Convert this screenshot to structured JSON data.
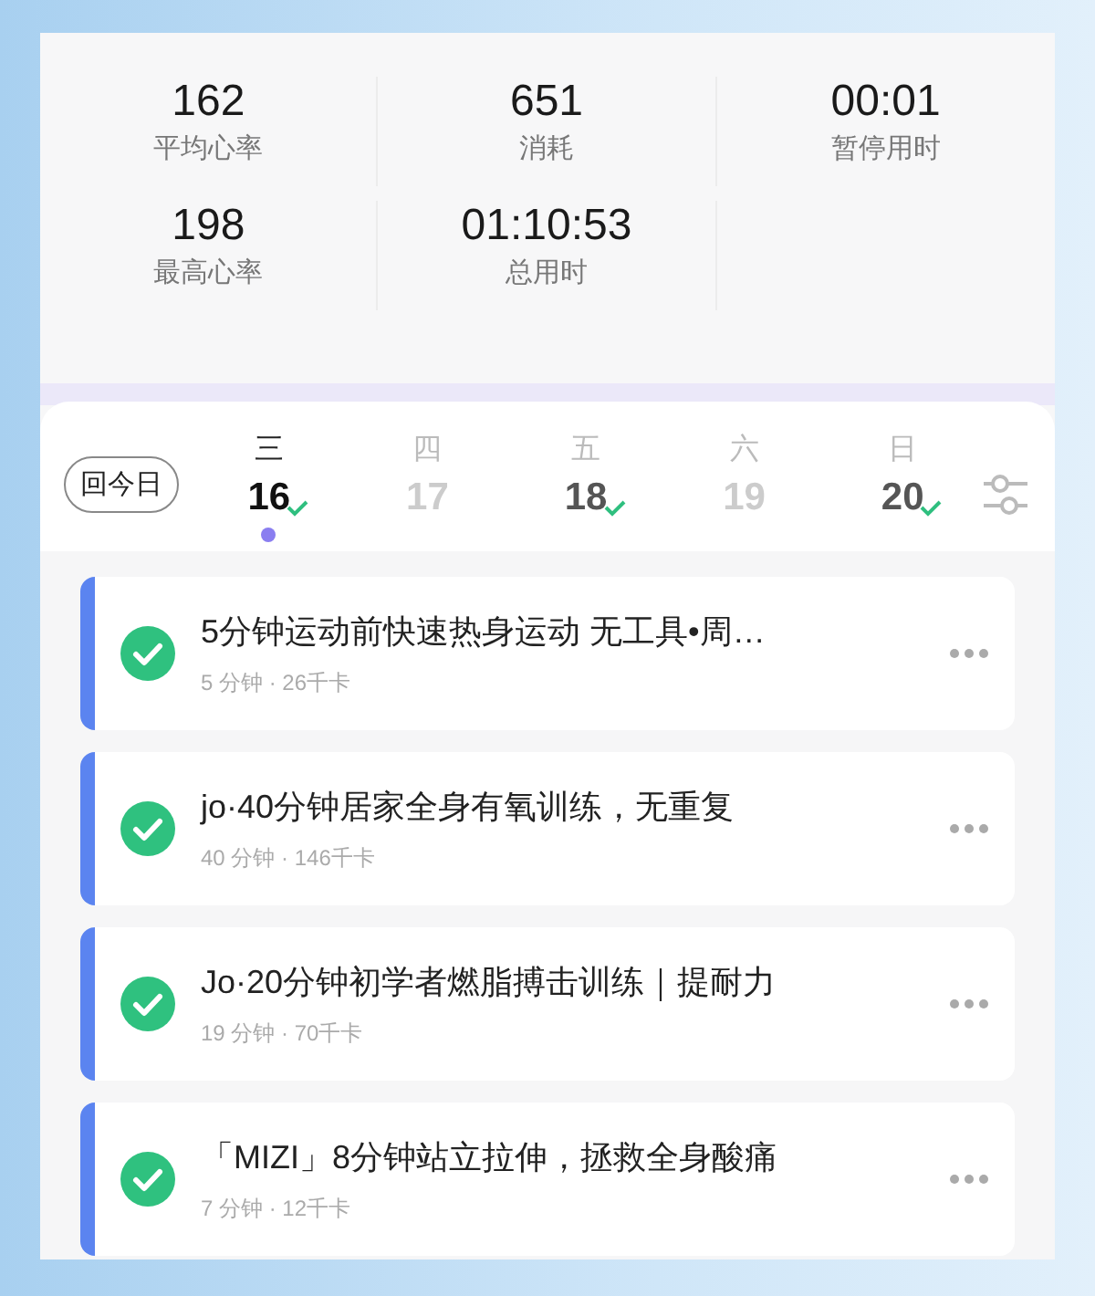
{
  "stats": [
    {
      "value": "162",
      "label": "平均心率"
    },
    {
      "value": "651",
      "label": "消耗"
    },
    {
      "value": "00:01",
      "label": "暂停用时"
    },
    {
      "value": "198",
      "label": "最高心率"
    },
    {
      "value": "01:10:53",
      "label": "总用时"
    }
  ],
  "today_button": "回今日",
  "days": [
    {
      "weekday": "三",
      "date": "16",
      "selected": true,
      "done": true
    },
    {
      "weekday": "四",
      "date": "17",
      "selected": false,
      "done": false
    },
    {
      "weekday": "五",
      "date": "18",
      "selected": false,
      "done": true
    },
    {
      "weekday": "六",
      "date": "19",
      "selected": false,
      "done": false
    },
    {
      "weekday": "日",
      "date": "20",
      "selected": false,
      "done": true
    }
  ],
  "workouts": [
    {
      "title": "5分钟运动前快速热身运动 无工具•周…",
      "meta": "5 分钟 · 26千卡",
      "completed": true
    },
    {
      "title": "jo·40分钟居家全身有氧训练，无重复",
      "meta": "40 分钟 · 146千卡",
      "completed": true
    },
    {
      "title": "Jo·20分钟初学者燃脂搏击训练｜提耐力",
      "meta": "19 分钟 · 70千卡",
      "completed": true
    },
    {
      "title": "「MIZI」8分钟站立拉伸，拯救全身酸痛",
      "meta": "7 分钟 · 12千卡",
      "completed": true
    }
  ]
}
